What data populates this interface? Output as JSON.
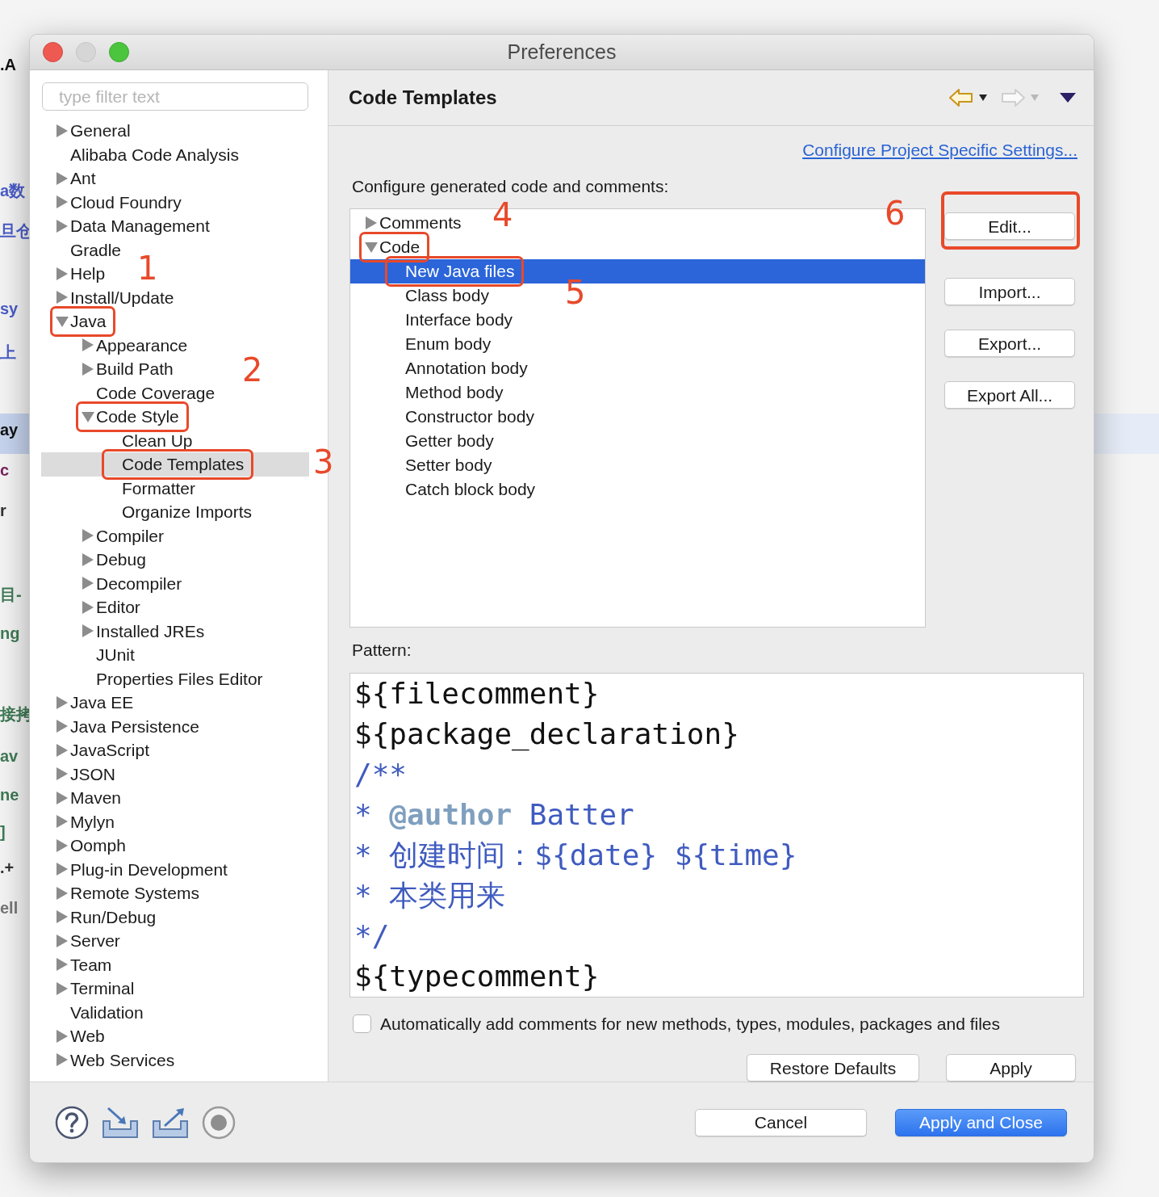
{
  "background_text": [
    {
      "text": ".A",
      "color": "#111111"
    },
    {
      "text": "a数",
      "color": "#4a5cc8"
    },
    {
      "text": "旦仓",
      "color": "#4a5cc8"
    },
    {
      "text": "sy",
      "color": "#4a5cc8"
    },
    {
      "text": "上",
      "color": "#4a5cc8"
    },
    {
      "text": "ay",
      "color": "#111111"
    },
    {
      "text": "c",
      "color": "#7a1f5c"
    },
    {
      "text": "r",
      "color": "#333333"
    },
    {
      "text": "目-",
      "color": "#3f7a55"
    },
    {
      "text": "ng",
      "color": "#3f7a55"
    },
    {
      "text": "接拷",
      "color": "#3f7a55"
    },
    {
      "text": "av",
      "color": "#3f7a55"
    },
    {
      "text": "ne",
      "color": "#3f7a55"
    },
    {
      "text": "]",
      "color": "#3f7a55"
    },
    {
      "text": ".+",
      "color": "#333333"
    },
    {
      "text": "ell",
      "color": "#777777"
    }
  ],
  "window": {
    "title": "Preferences"
  },
  "filter": {
    "placeholder": "type filter text"
  },
  "preference_tree": [
    {
      "label": "General",
      "kind": "folder",
      "expanded": false,
      "selected": false,
      "circled": false
    },
    {
      "label": "Alibaba Code Analysis",
      "kind": "leaf",
      "selected": false,
      "circled": false
    },
    {
      "label": "Ant",
      "kind": "folder",
      "expanded": false,
      "selected": false,
      "circled": false
    },
    {
      "label": "Cloud Foundry",
      "kind": "folder",
      "expanded": false,
      "selected": false,
      "circled": false
    },
    {
      "label": "Data Management",
      "kind": "folder",
      "expanded": false,
      "selected": false,
      "circled": false
    },
    {
      "label": "Gradle",
      "kind": "leaf",
      "selected": false,
      "circled": false
    },
    {
      "label": "Help",
      "kind": "folder",
      "expanded": false,
      "selected": false,
      "circled": false
    },
    {
      "label": "Install/Update",
      "kind": "folder",
      "expanded": false,
      "selected": false,
      "circled": false
    },
    {
      "label": "Java",
      "kind": "folder",
      "expanded": true,
      "selected": false,
      "circled": true,
      "children": [
        {
          "label": "Appearance",
          "kind": "folder",
          "expanded": false,
          "selected": false,
          "circled": false
        },
        {
          "label": "Build Path",
          "kind": "folder",
          "expanded": false,
          "selected": false,
          "circled": false
        },
        {
          "label": "Code Coverage",
          "kind": "leaf",
          "selected": false,
          "circled": false
        },
        {
          "label": "Code Style",
          "kind": "folder",
          "expanded": true,
          "selected": false,
          "circled": true,
          "children": [
            {
              "label": "Clean Up",
              "kind": "leaf",
              "selected": false,
              "circled": false
            },
            {
              "label": "Code Templates",
              "kind": "leaf",
              "selected": true,
              "circled": true
            },
            {
              "label": "Formatter",
              "kind": "leaf",
              "selected": false,
              "circled": false
            },
            {
              "label": "Organize Imports",
              "kind": "leaf",
              "selected": false,
              "circled": false
            }
          ]
        },
        {
          "label": "Compiler",
          "kind": "folder",
          "expanded": false,
          "selected": false,
          "circled": false
        },
        {
          "label": "Debug",
          "kind": "folder",
          "expanded": false,
          "selected": false,
          "circled": false
        },
        {
          "label": "Decompiler",
          "kind": "folder",
          "expanded": false,
          "selected": false,
          "circled": false
        },
        {
          "label": "Editor",
          "kind": "folder",
          "expanded": false,
          "selected": false,
          "circled": false
        },
        {
          "label": "Installed JREs",
          "kind": "folder",
          "expanded": false,
          "selected": false,
          "circled": false
        },
        {
          "label": "JUnit",
          "kind": "leaf",
          "selected": false,
          "circled": false
        },
        {
          "label": "Properties Files Editor",
          "kind": "leaf",
          "selected": false,
          "circled": false
        }
      ]
    },
    {
      "label": "Java EE",
      "kind": "folder",
      "expanded": false,
      "selected": false,
      "circled": false
    },
    {
      "label": "Java Persistence",
      "kind": "folder",
      "expanded": false,
      "selected": false,
      "circled": false
    },
    {
      "label": "JavaScript",
      "kind": "folder",
      "expanded": false,
      "selected": false,
      "circled": false
    },
    {
      "label": "JSON",
      "kind": "folder",
      "expanded": false,
      "selected": false,
      "circled": false
    },
    {
      "label": "Maven",
      "kind": "folder",
      "expanded": false,
      "selected": false,
      "circled": false
    },
    {
      "label": "Mylyn",
      "kind": "folder",
      "expanded": false,
      "selected": false,
      "circled": false
    },
    {
      "label": "Oomph",
      "kind": "folder",
      "expanded": false,
      "selected": false,
      "circled": false
    },
    {
      "label": "Plug-in Development",
      "kind": "folder",
      "expanded": false,
      "selected": false,
      "circled": false
    },
    {
      "label": "Remote Systems",
      "kind": "folder",
      "expanded": false,
      "selected": false,
      "circled": false
    },
    {
      "label": "Run/Debug",
      "kind": "folder",
      "expanded": false,
      "selected": false,
      "circled": false
    },
    {
      "label": "Server",
      "kind": "folder",
      "expanded": false,
      "selected": false,
      "circled": false
    },
    {
      "label": "Team",
      "kind": "folder",
      "expanded": false,
      "selected": false,
      "circled": false
    },
    {
      "label": "Terminal",
      "kind": "folder",
      "expanded": false,
      "selected": false,
      "circled": false
    },
    {
      "label": "Validation",
      "kind": "leaf",
      "selected": false,
      "circled": false
    },
    {
      "label": "Web",
      "kind": "folder",
      "expanded": false,
      "selected": false,
      "circled": false
    },
    {
      "label": "Web Services",
      "kind": "folder",
      "expanded": false,
      "selected": false,
      "circled": false
    }
  ],
  "page": {
    "title": "Code Templates",
    "link": "Configure Project Specific Settings...",
    "label": "Configure generated code and comments:"
  },
  "template_tree": [
    {
      "label": "Comments",
      "kind": "folder",
      "expanded": false,
      "selected": false,
      "circled": false
    },
    {
      "label": "Code",
      "kind": "folder",
      "expanded": true,
      "selected": false,
      "circled": true,
      "children": [
        {
          "label": "New Java files",
          "kind": "leaf",
          "selected": true,
          "circled": true
        },
        {
          "label": "Class body",
          "kind": "leaf",
          "selected": false,
          "circled": false
        },
        {
          "label": "Interface body",
          "kind": "leaf",
          "selected": false,
          "circled": false
        },
        {
          "label": "Enum body",
          "kind": "leaf",
          "selected": false,
          "circled": false
        },
        {
          "label": "Annotation body",
          "kind": "leaf",
          "selected": false,
          "circled": false
        },
        {
          "label": "Method body",
          "kind": "leaf",
          "selected": false,
          "circled": false
        },
        {
          "label": "Constructor body",
          "kind": "leaf",
          "selected": false,
          "circled": false
        },
        {
          "label": "Getter body",
          "kind": "leaf",
          "selected": false,
          "circled": false
        },
        {
          "label": "Setter body",
          "kind": "leaf",
          "selected": false,
          "circled": false
        },
        {
          "label": "Catch block body",
          "kind": "leaf",
          "selected": false,
          "circled": false
        }
      ]
    }
  ],
  "side_buttons": [
    {
      "label": "Edit...",
      "circled": true
    },
    {
      "label": "Import...",
      "circled": false
    },
    {
      "label": "Export...",
      "circled": false
    },
    {
      "label": "Export All...",
      "circled": false
    }
  ],
  "pattern": {
    "label": "Pattern:",
    "lines": [
      [
        {
          "kind": "code",
          "text": "${filecomment}"
        }
      ],
      [
        {
          "kind": "code",
          "text": "${package_declaration}"
        }
      ],
      [
        {
          "kind": "comment",
          "text": "/**"
        }
      ],
      [
        {
          "kind": "comment",
          "text": "* "
        },
        {
          "kind": "tag",
          "text": "@author"
        },
        {
          "kind": "comment",
          "text": " Batter"
        }
      ],
      [
        {
          "kind": "comment",
          "text": "* 创建时间：${date} ${time}"
        }
      ],
      [
        {
          "kind": "comment",
          "text": "* 本类用来"
        }
      ],
      [
        {
          "kind": "comment",
          "text": "*/"
        }
      ],
      [
        {
          "kind": "code",
          "text": "${typecomment}"
        }
      ]
    ]
  },
  "auto_comments": {
    "label": "Automatically add comments for new methods, types, modules, packages and files",
    "checked": false
  },
  "page_buttons": [
    "Restore Defaults",
    "Apply"
  ],
  "dialog_buttons": [
    {
      "label": "Cancel",
      "primary": false
    },
    {
      "label": "Apply and Close",
      "primary": true
    }
  ],
  "annotations": [
    {
      "label": "1"
    },
    {
      "label": "2"
    },
    {
      "label": "3"
    },
    {
      "label": "4"
    },
    {
      "label": "5"
    },
    {
      "label": "6"
    }
  ]
}
